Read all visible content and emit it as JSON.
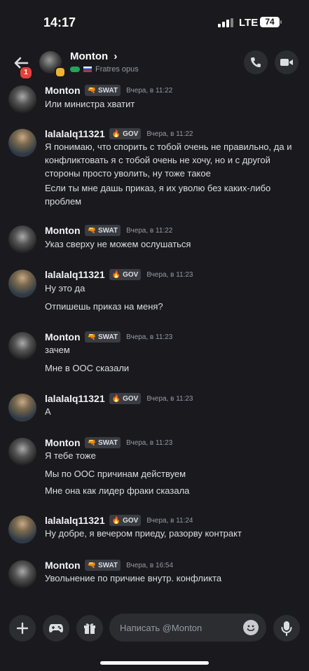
{
  "status_bar": {
    "time": "14:17",
    "network": "LTE",
    "battery": "74"
  },
  "header": {
    "badge": "1",
    "name": "Monton",
    "chevron": "›",
    "subtitle": "Fratres opus"
  },
  "messages": [
    {
      "author": "Monton",
      "tag_icon": "🔫",
      "tag": "SWAT",
      "time": "Вчера, в 11:22",
      "lines": [
        "Или министра хватит"
      ]
    },
    {
      "author": "lalalalq11321",
      "tag_icon": "🔥",
      "tag": "GOV",
      "time": "Вчера, в 11:22",
      "lines": [
        "Я понимаю, что спорить с тобой очень не правильно, да и конфликтовать я с тобой очень не хочу, но и с другой стороны просто уволить, ну тоже такое",
        "Если ты мне дашь приказ, я их уволю без каких-либо проблем"
      ]
    },
    {
      "author": "Monton",
      "tag_icon": "🔫",
      "tag": "SWAT",
      "time": "Вчера, в 11:22",
      "lines": [
        "Указ сверху не можем ослушаться"
      ]
    },
    {
      "author": "lalalalq11321",
      "tag_icon": "🔥",
      "tag": "GOV",
      "time": "Вчера, в 11:23",
      "lines": [
        "Ну это да",
        "Отпишешь приказ на меня?"
      ]
    },
    {
      "author": "Monton",
      "tag_icon": "🔫",
      "tag": "SWAT",
      "time": "Вчера, в 11:23",
      "lines": [
        "зачем",
        "Мне в ООС сказали"
      ]
    },
    {
      "author": "lalalalq11321",
      "tag_icon": "🔥",
      "tag": "GOV",
      "time": "Вчера, в 11:23",
      "lines": [
        "А"
      ]
    },
    {
      "author": "Monton",
      "tag_icon": "🔫",
      "tag": "SWAT",
      "time": "Вчера, в 11:23",
      "lines": [
        "Я тебе тоже",
        "Мы по ООС причинам действуем",
        "Мне она как лидер фраки сказала"
      ]
    },
    {
      "author": "lalalalq11321",
      "tag_icon": "🔥",
      "tag": "GOV",
      "time": "Вчера, в 11:24",
      "lines": [
        "Ну добре, я вечером приеду, разорву контракт"
      ]
    },
    {
      "author": "Monton",
      "tag_icon": "🔫",
      "tag": "SWAT",
      "time": "Вчера, в 16:54",
      "lines": [
        "Увольнение по причине внутр. конфликта"
      ]
    }
  ],
  "composer": {
    "placeholder": "Написать @Monton"
  }
}
